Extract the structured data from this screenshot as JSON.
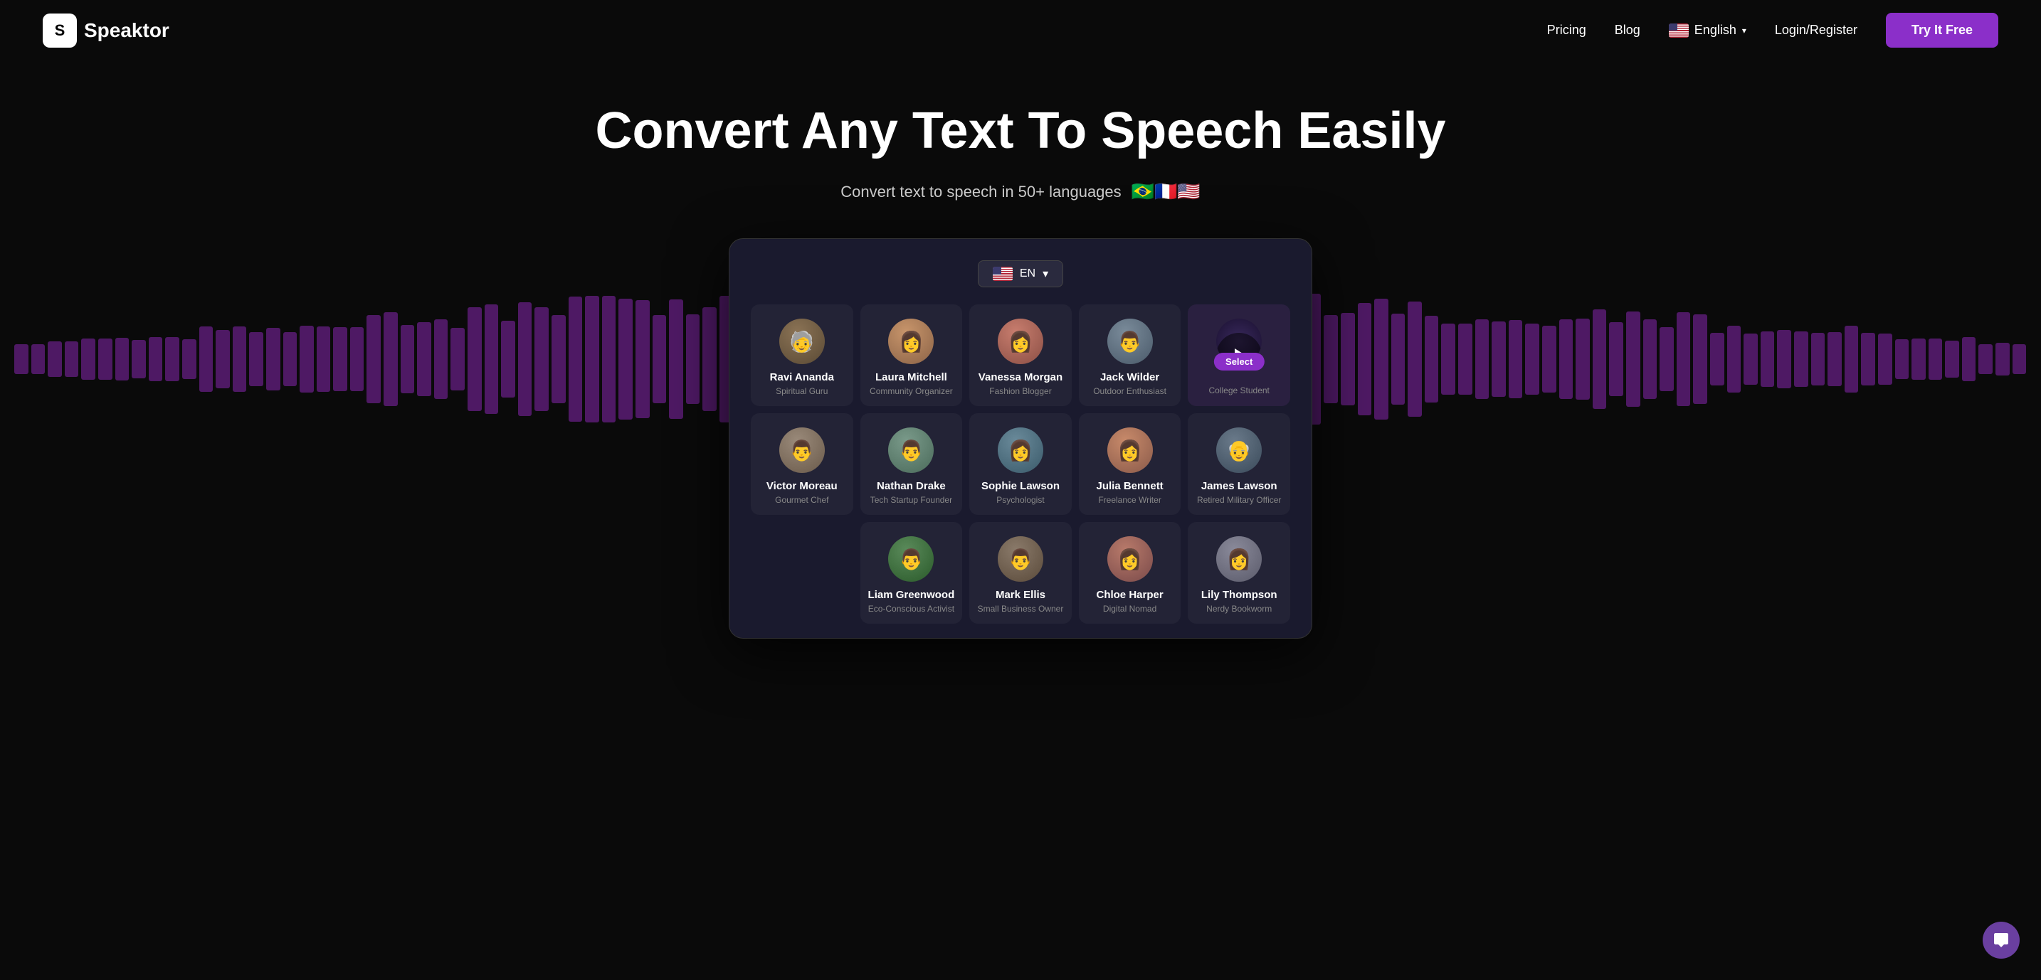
{
  "brand": {
    "logo_letter": "S",
    "name": "Speaktor"
  },
  "navbar": {
    "pricing_label": "Pricing",
    "blog_label": "Blog",
    "language_label": "English",
    "login_label": "Login/Register",
    "try_btn_label": "Try It Free"
  },
  "hero": {
    "title": "Convert Any Text To Speech Easily",
    "subtitle": "Convert text to speech in 50+ languages",
    "flags": [
      "🇧🇷",
      "🇫🇷",
      "🇺🇸"
    ]
  },
  "app": {
    "lang_label": "EN",
    "voices_row1": [
      {
        "id": "ravi",
        "name": "Ravi Ananda",
        "role": "Spiritual Guru",
        "avatar_class": "avatar-ravi",
        "emoji": "🧓"
      },
      {
        "id": "laura",
        "name": "Laura Mitchell",
        "role": "Community Organizer",
        "avatar_class": "avatar-laura",
        "emoji": "👩"
      },
      {
        "id": "vanessa",
        "name": "Vanessa Morgan",
        "role": "Fashion Blogger",
        "avatar_class": "avatar-vanessa",
        "emoji": "👩"
      },
      {
        "id": "jack",
        "name": "Jack Wilder",
        "role": "Outdoor Enthusiast",
        "avatar_class": "avatar-jack",
        "emoji": "👨"
      }
    ],
    "selected_voice": {
      "name": "Select",
      "role": "College Student",
      "avatar_class": "avatar-select"
    },
    "voices_row2": [
      {
        "id": "victor",
        "name": "Victor Moreau",
        "role": "Gourmet Chef",
        "avatar_class": "avatar-victor",
        "emoji": "👨"
      },
      {
        "id": "nathan",
        "name": "Nathan Drake",
        "role": "Tech Startup Founder",
        "avatar_class": "avatar-nathan",
        "emoji": "👨"
      },
      {
        "id": "sophie",
        "name": "Sophie Lawson",
        "role": "Psychologist",
        "avatar_class": "avatar-sophie",
        "emoji": "👩"
      },
      {
        "id": "julia",
        "name": "Julia Bennett",
        "role": "Freelance Writer",
        "avatar_class": "avatar-julia",
        "emoji": "👩"
      },
      {
        "id": "james",
        "name": "James Lawson",
        "role": "Retired Military Officer",
        "avatar_class": "avatar-james",
        "emoji": "👴"
      }
    ],
    "voices_row3": [
      {
        "id": "liam",
        "name": "Liam Greenwood",
        "role": "Eco-Conscious Activist",
        "avatar_class": "avatar-liam",
        "emoji": "👨"
      },
      {
        "id": "mark",
        "name": "Mark Ellis",
        "role": "Small Business Owner",
        "avatar_class": "avatar-mark",
        "emoji": "👨"
      },
      {
        "id": "chloe",
        "name": "Chloe Harper",
        "role": "Digital Nomad",
        "avatar_class": "avatar-chloe",
        "emoji": "👩"
      },
      {
        "id": "lily",
        "name": "Lily Thompson",
        "role": "Nerdy Bookworm",
        "avatar_class": "avatar-lily",
        "emoji": "👩"
      }
    ],
    "select_badge_label": "Select"
  }
}
